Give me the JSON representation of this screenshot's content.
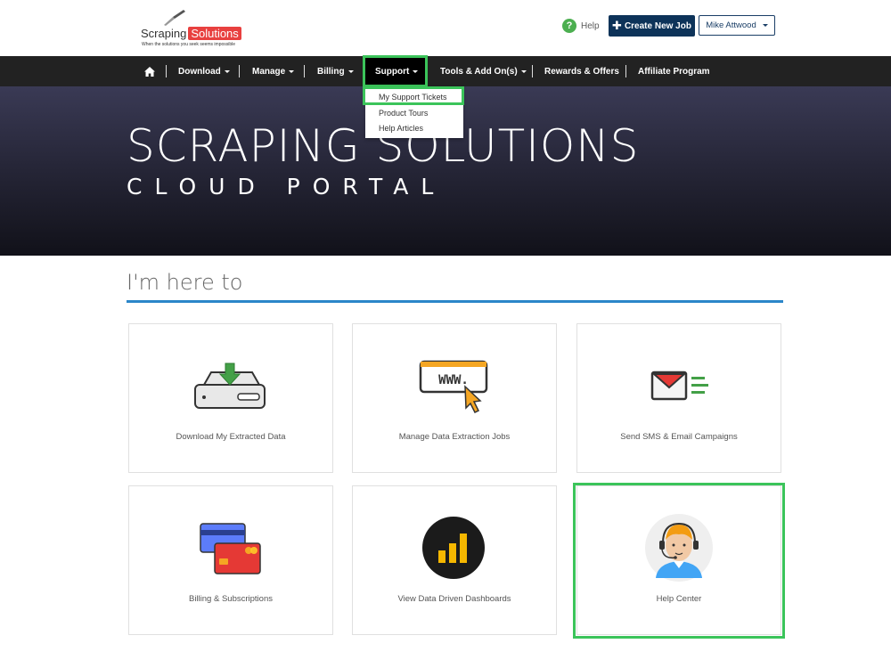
{
  "header": {
    "logo": {
      "brand_part1": "Scraping",
      "brand_part2": "Solutions",
      "tagline": "When the solutions you seek seems impossible"
    },
    "help_label": "Help",
    "help_icon": "question-circle-icon",
    "create_job_label": "Create New Job",
    "user_name": "Mike Attwood"
  },
  "nav": {
    "home_icon": "home-icon",
    "items": [
      {
        "label": "Download"
      },
      {
        "label": "Manage"
      },
      {
        "label": "Billing"
      },
      {
        "label": "Support"
      },
      {
        "label": "Tools & Add On(s)"
      },
      {
        "label": "Rewards & Offers"
      },
      {
        "label": "Affiliate Program"
      }
    ]
  },
  "support_dropdown": {
    "items": [
      {
        "label": "My Support Tickets"
      },
      {
        "label": "Product Tours"
      },
      {
        "label": "Help Articles"
      }
    ]
  },
  "hero": {
    "title": "SCRAPING SOLUTIONS",
    "subtitle": "CLOUD PORTAL"
  },
  "section": {
    "title": "I'm here to"
  },
  "cards": [
    {
      "label": "Download My Extracted Data",
      "icon": "download-drive-icon"
    },
    {
      "label": "Manage Data Extraction Jobs",
      "icon": "www-cursor-icon"
    },
    {
      "label": "Send SMS & Email Campaigns",
      "icon": "email-icon"
    },
    {
      "label": "Billing & Subscriptions",
      "icon": "credit-cards-icon"
    },
    {
      "label": "View Data Driven Dashboards",
      "icon": "bar-chart-icon"
    },
    {
      "label": "Help Center",
      "icon": "support-agent-icon"
    }
  ],
  "colors": {
    "highlight": "#3bc45a",
    "navbar": "#222222",
    "primary_button": "#0d3359",
    "accent_rule": "#2b86c9",
    "brand_red": "#e8403f"
  },
  "icons": {
    "text": "WWW."
  }
}
